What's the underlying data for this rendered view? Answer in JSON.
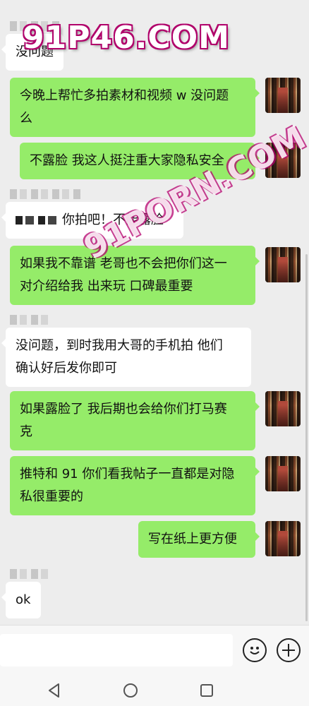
{
  "watermarks": {
    "main": "91P46.COM",
    "diagonal": "91PORN.COM"
  },
  "messages": [
    {
      "side": "in",
      "text": "没问题"
    },
    {
      "side": "out",
      "lines": [
        "今晚上帮忙多拍素材和视频 w 没问题",
        "么"
      ]
    },
    {
      "side": "out",
      "text": "不露脸 我这人挺注重大家隐私安全"
    },
    {
      "side": "in",
      "text": "你拍吧！不能露脸"
    },
    {
      "side": "out",
      "lines": [
        "如果我不靠谱 老哥也不会把你们这一",
        "对介绍给我 出来玩 口碑最重要"
      ]
    },
    {
      "side": "in",
      "lines": [
        "没问题，到时我用大哥的手机拍 他们",
        "确认好后发你即可"
      ]
    },
    {
      "side": "out",
      "lines": [
        "如果露脸了 我后期也会给你们打马赛",
        "克"
      ]
    },
    {
      "side": "out",
      "lines": [
        "推特和 91 你们看我帖子一直都是对隐",
        "私很重要的"
      ]
    },
    {
      "side": "out",
      "text": "写在纸上更方便"
    },
    {
      "side": "in",
      "text": "ok"
    }
  ],
  "icons": {
    "emoji": "emoji-icon",
    "plus": "plus-icon",
    "back": "back-icon",
    "home": "home-icon",
    "recents": "recents-icon"
  }
}
